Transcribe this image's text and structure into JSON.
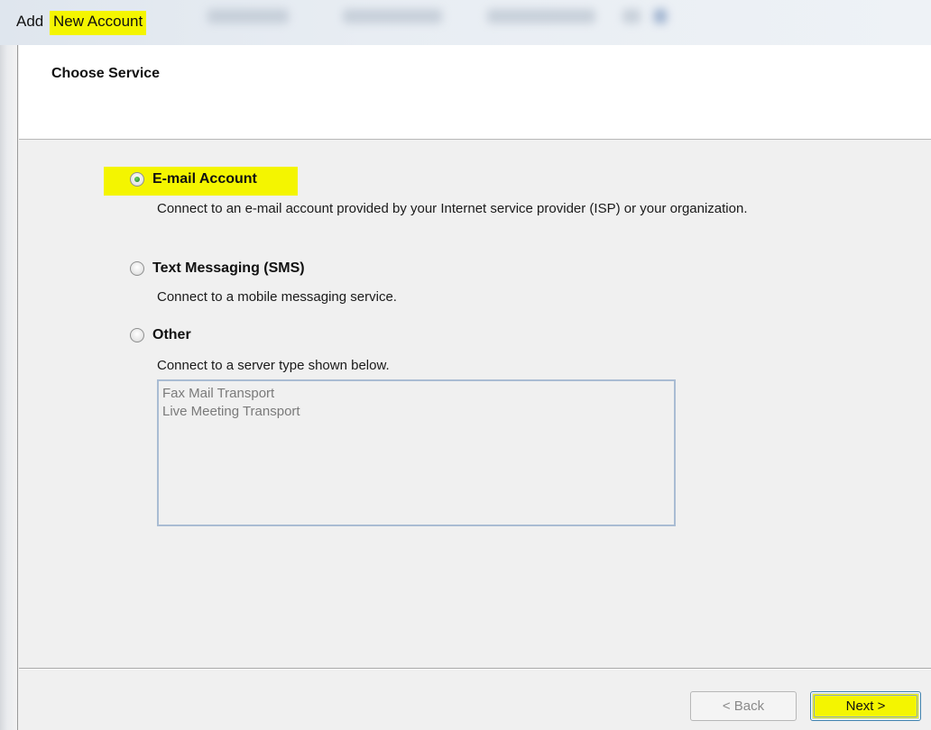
{
  "window": {
    "title_prefix": "Add ",
    "title_highlight": "New Account"
  },
  "header": {
    "title": "Choose Service"
  },
  "options": [
    {
      "label": "E-mail Account",
      "selected": true,
      "description": "Connect to an e-mail account provided by your Internet service provider (ISP) or your organization."
    },
    {
      "label": "Text Messaging (SMS)",
      "selected": false,
      "description": "Connect to a mobile messaging service."
    },
    {
      "label": "Other",
      "selected": false,
      "description": "Connect to a server type shown below."
    }
  ],
  "server_types": [
    "Fax Mail Transport",
    "Live Meeting Transport"
  ],
  "buttons": {
    "back": "< Back",
    "next": "Next >"
  },
  "colors": {
    "highlight": "#f4f500",
    "radio_selected": "#2e8b2e"
  }
}
